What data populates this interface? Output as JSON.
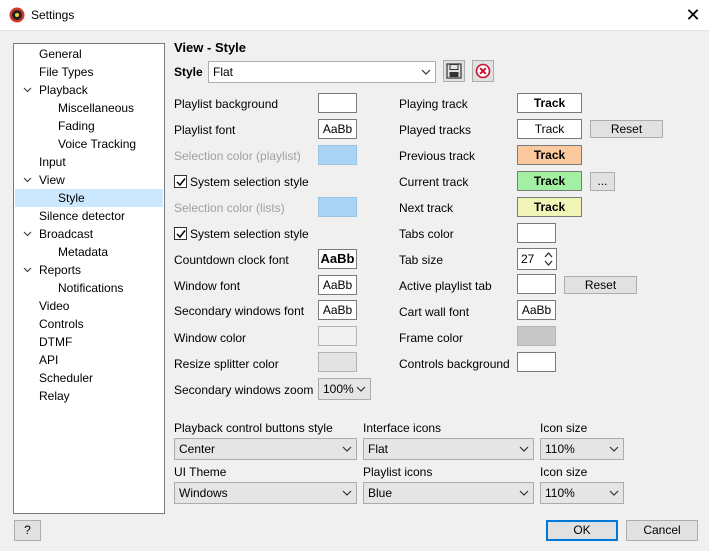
{
  "window": {
    "title": "Settings",
    "close_glyph": "✕"
  },
  "tree": {
    "items": [
      {
        "label": "General"
      },
      {
        "label": "File Types"
      },
      {
        "label": "Playback"
      },
      {
        "label": "Miscellaneous"
      },
      {
        "label": "Fading"
      },
      {
        "label": "Voice Tracking"
      },
      {
        "label": "Input"
      },
      {
        "label": "View"
      },
      {
        "label": "Style"
      },
      {
        "label": "Silence detector"
      },
      {
        "label": "Broadcast"
      },
      {
        "label": "Metadata"
      },
      {
        "label": "Reports"
      },
      {
        "label": "Notifications"
      },
      {
        "label": "Video"
      },
      {
        "label": "Controls"
      },
      {
        "label": "DTMF"
      },
      {
        "label": "API"
      },
      {
        "label": "Scheduler"
      },
      {
        "label": "Relay"
      }
    ]
  },
  "page": {
    "title": "View - Style",
    "style_label": "Style",
    "style_value": "Flat"
  },
  "left": {
    "playlist_background": "Playlist background",
    "playlist_font": "Playlist font",
    "playlist_font_sample": "AaBb",
    "selection_color_playlist": "Selection color (playlist)",
    "system_selection_style_1": "System selection style",
    "selection_color_lists": "Selection color (lists)",
    "system_selection_style_2": "System selection style",
    "countdown_clock_font": "Countdown clock font",
    "countdown_clock_sample": "AaBb",
    "window_font": "Window font",
    "window_font_sample": "AaBb",
    "secondary_windows_font": "Secondary windows font",
    "secondary_windows_font_sample": "AaBb",
    "window_color": "Window color",
    "resize_splitter_color": "Resize splitter color",
    "secondary_windows_zoom": "Secondary windows zoom",
    "secondary_windows_zoom_value": "100%"
  },
  "right": {
    "playing_track": "Playing track",
    "played_tracks": "Played tracks",
    "previous_track": "Previous track",
    "current_track": "Current track",
    "next_track": "Next track",
    "tabs_color": "Tabs color",
    "tab_size": "Tab size",
    "tab_size_value": "27",
    "active_playlist_tab": "Active playlist tab",
    "cart_wall_font": "Cart wall font",
    "cart_wall_font_sample": "AaBb",
    "frame_color": "Frame color",
    "controls_background": "Controls background",
    "track_sample": "Track",
    "reset": "Reset",
    "ellipsis": "..."
  },
  "bottom": {
    "playback_control_buttons_style": "Playback control buttons style",
    "playback_control_buttons_value": "Center",
    "interface_icons": "Interface icons",
    "interface_icons_value": "Flat",
    "icon_size_1": "Icon size",
    "icon_size_1_value": "110%",
    "ui_theme": "UI Theme",
    "ui_theme_value": "Windows",
    "playlist_icons": "Playlist icons",
    "playlist_icons_value": "Blue",
    "icon_size_2": "Icon size",
    "icon_size_2_value": "110%"
  },
  "footer": {
    "help": "?",
    "ok": "OK",
    "cancel": "Cancel"
  },
  "colors": {
    "selection": "#aad4f5",
    "previous_track": "#fac99e",
    "current_track": "#a3f0a3",
    "next_track": "#f2f5b8",
    "window_color": "#f0f0f0",
    "splitter": "#e3e3e3",
    "frame": "#c8c8c8",
    "accent": "#0078d7"
  }
}
